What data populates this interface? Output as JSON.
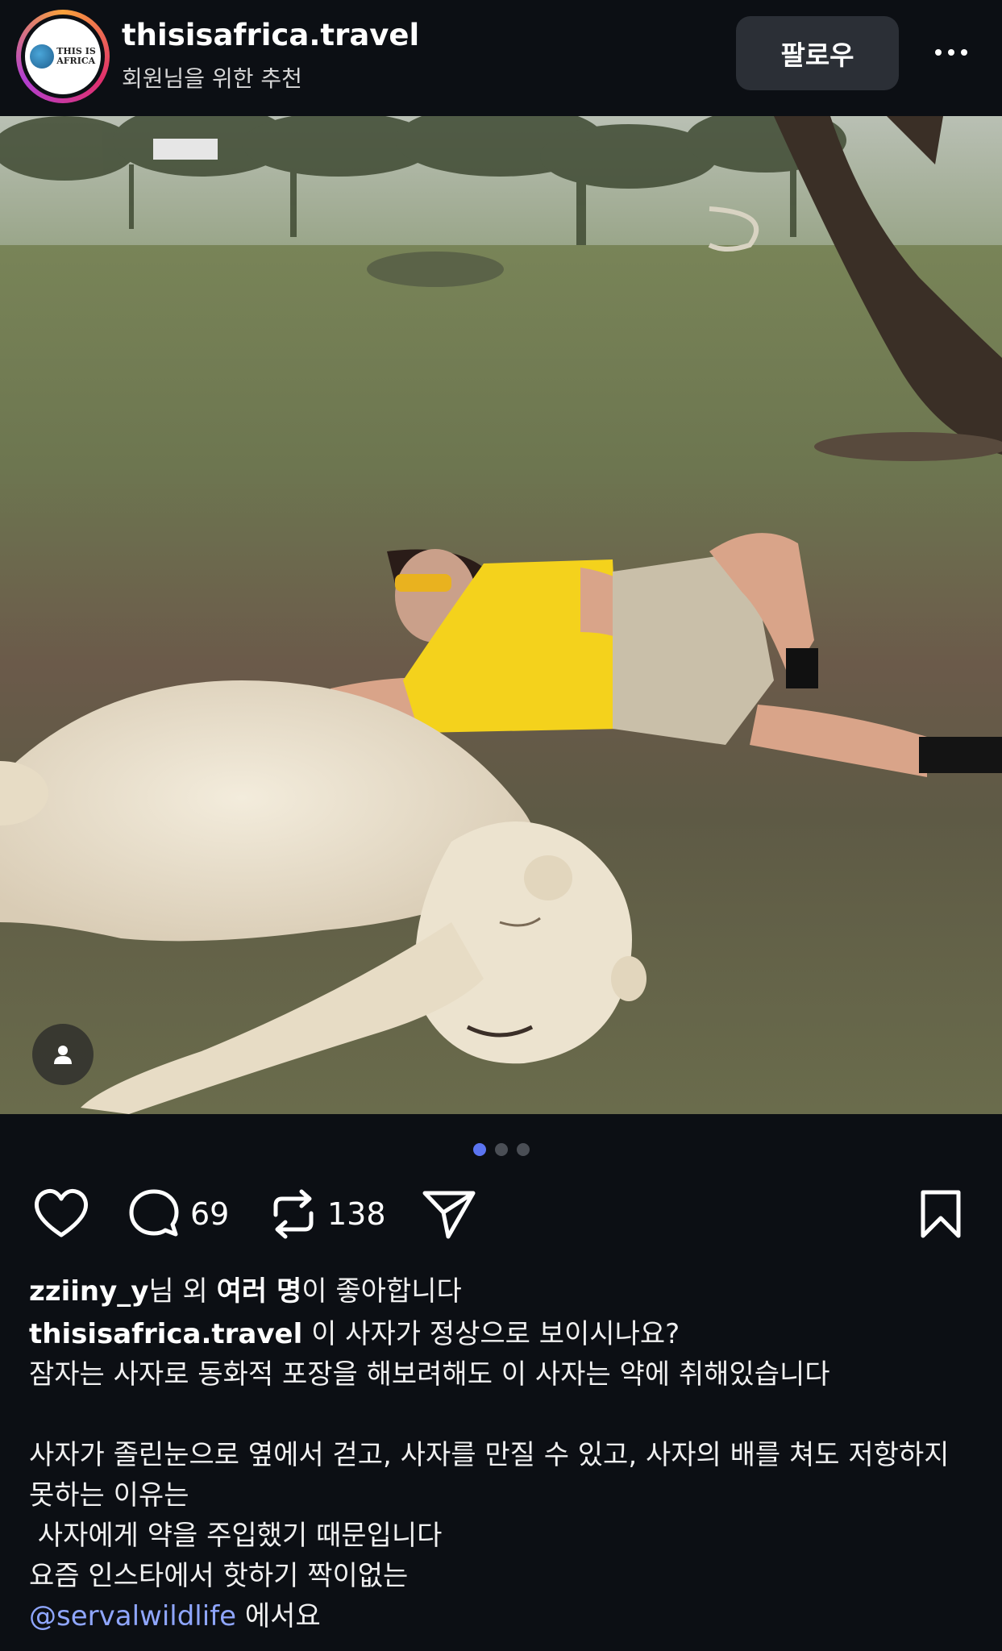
{
  "header": {
    "username": "thisisafrica.travel",
    "subtitle": "회원님을 위한 추천",
    "follow_label": "팔로우",
    "logo_line1": "THIS IS",
    "logo_line2": "AFRICA"
  },
  "carousel": {
    "count": 3,
    "active": 1
  },
  "actions": {
    "comments": "69",
    "reposts": "138"
  },
  "likes": {
    "user": "zziiny_y",
    "middle": "님 외 ",
    "bold": "여러 명",
    "end": "이 좋아합니다"
  },
  "caption": {
    "owner": "thisisafrica.travel",
    "line1": " 이 사자가 정상으로 보이시나요?",
    "line2": "잠자는 사자로 동화적 포장을 해보려해도 이 사자는 약에 취해있습니다",
    "line3": "사자가 졸린눈으로 옆에서 걷고, 사자를 만질 수 있고, 사자의 배를 쳐도 저항하지 못하는 이유는",
    "line4": " 사자에게 약을 주입했기 때문입니다",
    "line5": "요즘 인스타에서 핫하기 짝이없는",
    "mention": "@servalwildlife",
    "line6": " 에서요"
  },
  "colors": {
    "background": "#0c0f14",
    "mention": "#8fa6ff",
    "active_dot": "#5b74f1"
  }
}
